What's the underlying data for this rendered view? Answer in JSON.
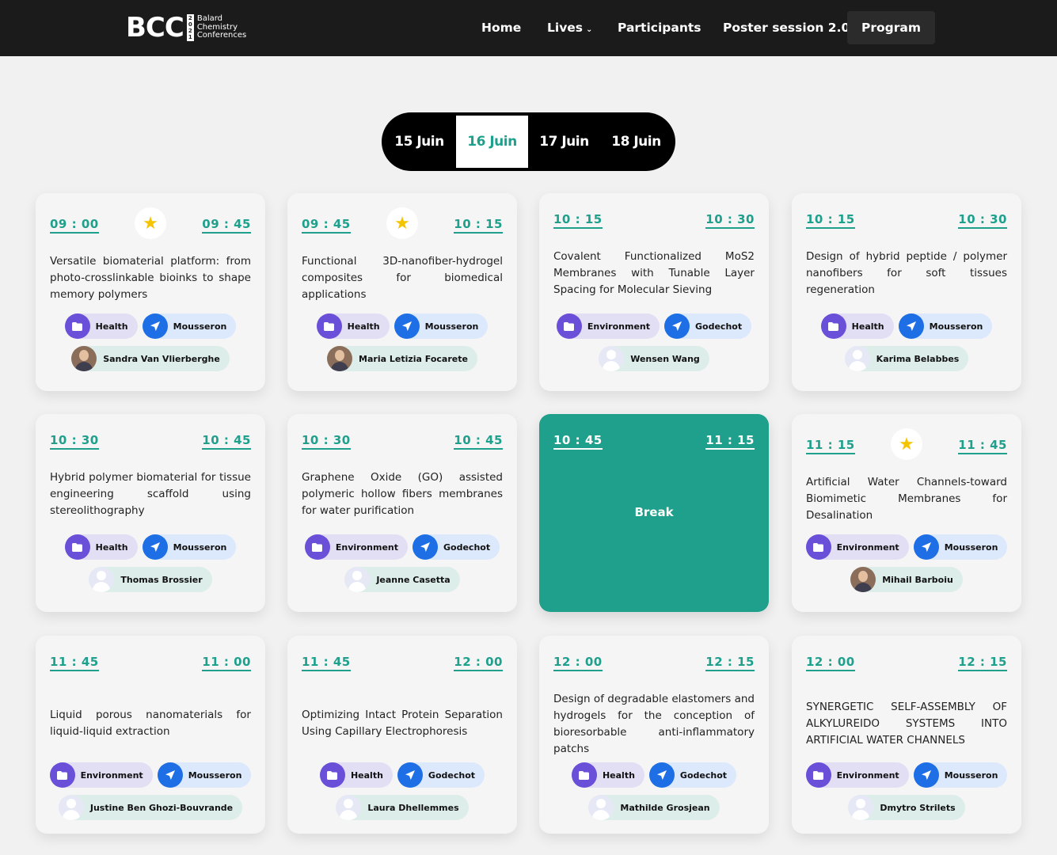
{
  "nav": {
    "logo_mark": "BCC",
    "logo_year": [
      "2",
      "0",
      "2",
      "1"
    ],
    "logo_text": [
      "Balard",
      "Chemistry",
      "Conferences"
    ],
    "items": [
      {
        "label": "Home"
      },
      {
        "label": "Lives",
        "caret": "⌄"
      },
      {
        "label": "Participants"
      },
      {
        "label": "Poster session 2.0"
      },
      {
        "label": "Program",
        "active": true
      }
    ]
  },
  "days": {
    "selected": "16 Juin",
    "tabs": [
      "15 Juin",
      "16 Juin",
      "17 Juin",
      "18 Juin"
    ]
  },
  "colors": {
    "accent": "#1fa08c",
    "topic": "#6a4fd8",
    "location": "#1e6fe6",
    "star": "#f5c400"
  },
  "icons": {
    "star": "star-icon",
    "topic": "folder-icon",
    "location": "location-arrow-icon",
    "avatar": "user-avatar"
  },
  "sessions": [
    {
      "start": "09 : 00",
      "end": "09 : 45",
      "starred": true,
      "title": "Versatile biomaterial platform: from photo-crosslinkable bioinks to shape memory polymers",
      "topic": "Health",
      "location": "Mousseron",
      "speaker": "Sandra Van Vlierberghe",
      "avatar": "photo"
    },
    {
      "start": "09 : 45",
      "end": "10 : 15",
      "starred": true,
      "title": "Functional 3D-nanofiber-hydrogel composites for biomedical applications",
      "topic": "Health",
      "location": "Mousseron",
      "speaker": "Maria Letizia Focarete",
      "avatar": "photo"
    },
    {
      "start": "10 : 15",
      "end": "10 : 30",
      "starred": false,
      "title": "Covalent Functionalized MoS2 Membranes with Tunable Layer Spacing for Molecular Sieving",
      "topic": "Environment",
      "location": "Godechot",
      "speaker": "Wensen Wang",
      "avatar": "default"
    },
    {
      "start": "10 : 15",
      "end": "10 : 30",
      "starred": false,
      "title": "Design of hybrid peptide / polymer nanofibers for soft tissues regeneration",
      "topic": "Health",
      "location": "Mousseron",
      "speaker": "Karima Belabbes",
      "avatar": "default"
    },
    {
      "start": "10 : 30",
      "end": "10 : 45",
      "starred": false,
      "title": "Hybrid polymer biomaterial for tissue engineering scaffold using stereolithography",
      "topic": "Health",
      "location": "Mousseron",
      "speaker": "Thomas Brossier",
      "avatar": "default"
    },
    {
      "start": "10 : 30",
      "end": "10 : 45",
      "starred": false,
      "title": "Graphene Oxide (GO) assisted polymeric hollow fibers membranes for water purification",
      "topic": "Environment",
      "location": "Godechot",
      "speaker": "Jeanne Casetta",
      "avatar": "default"
    },
    {
      "start": "10 : 45",
      "end": "11 : 15",
      "break": true,
      "label": "Break"
    },
    {
      "start": "11 : 15",
      "end": "11 : 45",
      "starred": true,
      "title": "Artificial Water Channels-toward Biomimetic Membranes for Desalination",
      "topic": "Environment",
      "location": "Mousseron",
      "speaker": "Mihail Barboiu",
      "avatar": "photo"
    },
    {
      "start": "11 : 45",
      "end": "11 : 00",
      "starred": false,
      "title": "Liquid porous nanomaterials for liquid-liquid extraction",
      "topic": "Environment",
      "location": "Mousseron",
      "speaker": "Justine Ben Ghozi-Bouvrande",
      "avatar": "default"
    },
    {
      "start": "11 : 45",
      "end": "12 : 00",
      "starred": false,
      "title": "Optimizing Intact Protein Separation Using Capillary Electrophoresis",
      "topic": "Health",
      "location": "Godechot",
      "speaker": "Laura Dhellemmes",
      "avatar": "default"
    },
    {
      "start": "12 : 00",
      "end": "12 : 15",
      "starred": false,
      "title": "Design of degradable elastomers and hydrogels for the conception of bioresorbable anti-inflammatory patchs",
      "topic": "Health",
      "location": "Godechot",
      "speaker": "Mathilde Grosjean",
      "avatar": "default"
    },
    {
      "start": "12 : 00",
      "end": "12 : 15",
      "starred": false,
      "title": "SYNERGETIC SELF-ASSEMBLY OF ALKYLUREIDO SYSTEMS INTO ARTIFICIAL WATER CHANNELS",
      "topic": "Environment",
      "location": "Mousseron",
      "speaker": "Dmytro Strilets",
      "avatar": "default"
    }
  ]
}
